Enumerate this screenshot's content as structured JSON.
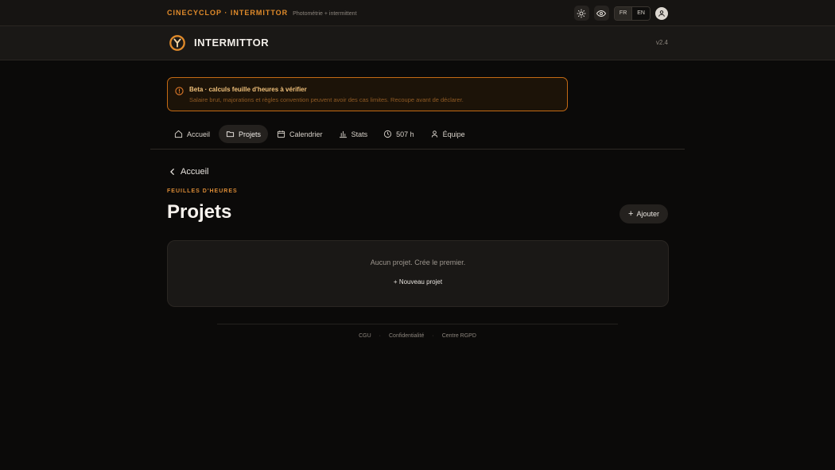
{
  "topbar": {
    "brand": "CINECYCLOP · INTERMITTOR",
    "tagline": "Photométrie + intermittent",
    "lang_active": "FR",
    "lang_other": "EN"
  },
  "header": {
    "title": "INTERMITTOR",
    "version": "v2.4"
  },
  "banner": {
    "title": "Beta · calculs feuille d'heures à vérifier",
    "text": "Salaire brut, majorations et règles convention peuvent avoir des cas limites. Recoupe avant de déclarer."
  },
  "nav": {
    "items": [
      {
        "label": "Accueil",
        "icon": "home-icon"
      },
      {
        "label": "Projets",
        "icon": "folder-icon"
      },
      {
        "label": "Calendrier",
        "icon": "calendar-icon"
      },
      {
        "label": "Stats",
        "icon": "bar-chart-icon"
      },
      {
        "label": "507 h",
        "icon": "clock-icon"
      },
      {
        "label": "Équipe",
        "icon": "user-icon"
      }
    ]
  },
  "main": {
    "back_label": "Accueil",
    "eyebrow": "FEUILLES D'HEURES",
    "title": "Projets",
    "add_label": "Ajouter",
    "empty_text": "Aucun projet. Crée le premier.",
    "new_project_label": "+ Nouveau projet"
  },
  "footer": {
    "links": [
      "CGU",
      "Confidentialité",
      "Centre RGPD"
    ],
    "separator": "·"
  },
  "colors": {
    "accent": "#e08a2a",
    "banner_border": "#c46a14",
    "background": "#0b0a09"
  }
}
